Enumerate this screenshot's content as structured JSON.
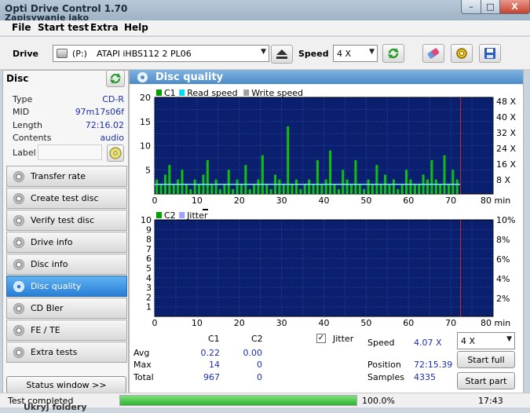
{
  "window": {
    "title": "Opti Drive Control 1.70",
    "background_title": "Zapisywanie jako",
    "buttons": {
      "minimize": "–",
      "maximize": "□",
      "close": "X"
    }
  },
  "menu": [
    "File",
    "Start test",
    "Extra",
    "Help"
  ],
  "toolbar": {
    "drive_label": "Drive",
    "drive_letter": "(P:)",
    "drive_name": "ATAPI iHBS112   2 PL06",
    "speed_label": "Speed",
    "speed_value": "4 X",
    "icons": [
      "eject-icon",
      "refresh-icon",
      "eraser-icon",
      "settings-icon",
      "save-icon"
    ]
  },
  "disc": {
    "header": "Disc",
    "rows": [
      {
        "label": "Type",
        "value": "CD-R"
      },
      {
        "label": "MID",
        "value": "97m17s06f"
      },
      {
        "label": "Length",
        "value": "72:16.02"
      },
      {
        "label": "Contents",
        "value": "audio"
      }
    ],
    "label_field": "Label",
    "label_value": ""
  },
  "nav": [
    {
      "label": "Transfer rate",
      "active": false
    },
    {
      "label": "Create test disc",
      "active": false
    },
    {
      "label": "Verify test disc",
      "active": false
    },
    {
      "label": "Drive info",
      "active": false
    },
    {
      "label": "Disc info",
      "active": false
    },
    {
      "label": "Disc quality",
      "active": true
    },
    {
      "label": "CD Bler",
      "active": false
    },
    {
      "label": "FE / TE",
      "active": false
    },
    {
      "label": "Extra tests",
      "active": false
    }
  ],
  "status_window_button": "Status window >>",
  "panel_title": "Disc quality",
  "chart_data": [
    {
      "type": "bar",
      "legend": [
        "C1",
        "Read speed",
        "Write speed"
      ],
      "legend_colors": [
        "#00a000",
        "#00d8ff",
        "#a0a0a0"
      ],
      "x_ticks": [
        "0",
        "10",
        "20",
        "30",
        "40",
        "50",
        "60",
        "70",
        "80 min"
      ],
      "xlim": [
        0,
        80
      ],
      "ylim": [
        0,
        20
      ],
      "y_ticks_left": [
        "20",
        "15",
        "10",
        "5"
      ],
      "y_ticks_right": [
        "48 X",
        "40 X",
        "32 X",
        "24 X",
        "16 X",
        "8 X"
      ],
      "marker_x": 72.3,
      "speed_line_y": 2,
      "x": [
        0.5,
        1.5,
        2.5,
        3.5,
        4.5,
        5.5,
        6.5,
        7.5,
        8.5,
        9.5,
        10.5,
        11.5,
        12.5,
        13.5,
        14.5,
        15.5,
        16.5,
        17.5,
        18.5,
        19.5,
        20.5,
        21.5,
        22.5,
        23.5,
        24.5,
        25.5,
        26.5,
        27.5,
        28.5,
        29.5,
        30.5,
        31.5,
        32.5,
        33.5,
        34.5,
        35.5,
        36.5,
        37.5,
        38.5,
        39.5,
        40.5,
        41.5,
        42.5,
        43.5,
        44.5,
        45.5,
        46.5,
        47.5,
        48.5,
        49.5,
        50.5,
        51.5,
        52.5,
        53.5,
        54.5,
        55.5,
        56.5,
        57.5,
        58.5,
        59.5,
        60.5,
        61.5,
        62.5,
        63.5,
        64.5,
        65.5,
        66.5,
        67.5,
        68.5,
        69.5,
        70.5,
        71.5
      ],
      "values": [
        3,
        2,
        4,
        6,
        2,
        3,
        5,
        2,
        1,
        3,
        2,
        4,
        7,
        2,
        3,
        1,
        2,
        5,
        1,
        3,
        2,
        6,
        1,
        2,
        3,
        8,
        2,
        1,
        4,
        3,
        2,
        14,
        2,
        3,
        1,
        2,
        3,
        2,
        7,
        2,
        3,
        9,
        2,
        1,
        5,
        3,
        2,
        7,
        2,
        1,
        3,
        2,
        6,
        2,
        4,
        2,
        3,
        1,
        2,
        5,
        3,
        2,
        2,
        4,
        3,
        7,
        3,
        2,
        8,
        2,
        5,
        3
      ]
    },
    {
      "type": "bar",
      "legend": [
        "C2",
        "Jitter"
      ],
      "legend_colors": [
        "#00a000",
        "#a0a0ff"
      ],
      "x_ticks": [
        "0",
        "10",
        "20",
        "30",
        "40",
        "50",
        "60",
        "70",
        "80 min"
      ],
      "xlim": [
        0,
        80
      ],
      "ylim": [
        0,
        10
      ],
      "y_ticks_left": [
        "10",
        "9",
        "8",
        "7",
        "6",
        "5",
        "4",
        "3",
        "2",
        "1"
      ],
      "y_ticks_right": [
        "10%",
        "8%",
        "6%",
        "4%",
        "2%"
      ],
      "marker_x": 72.3,
      "values": []
    }
  ],
  "stats": {
    "col_c1": "C1",
    "col_c2": "C2",
    "rows": [
      {
        "label": "Avg",
        "c1": "0.22",
        "c2": "0.00"
      },
      {
        "label": "Max",
        "c1": "14",
        "c2": "0"
      },
      {
        "label": "Total",
        "c1": "967",
        "c2": "0"
      }
    ],
    "jitter_label": "Jitter",
    "jitter_checked": true,
    "speed_label": "Speed",
    "speed_value": "4.07 X",
    "position_label": "Position",
    "position_value": "72:15.39",
    "samples_label": "Samples",
    "samples_value": "4335",
    "speed_select": "4 X",
    "start_full": "Start full",
    "start_part": "Start part"
  },
  "status": {
    "text": "Test completed",
    "progress_percent": 100,
    "progress_text": "100.0%",
    "time": "17:43",
    "behind_text": "Ukryj foldery"
  }
}
